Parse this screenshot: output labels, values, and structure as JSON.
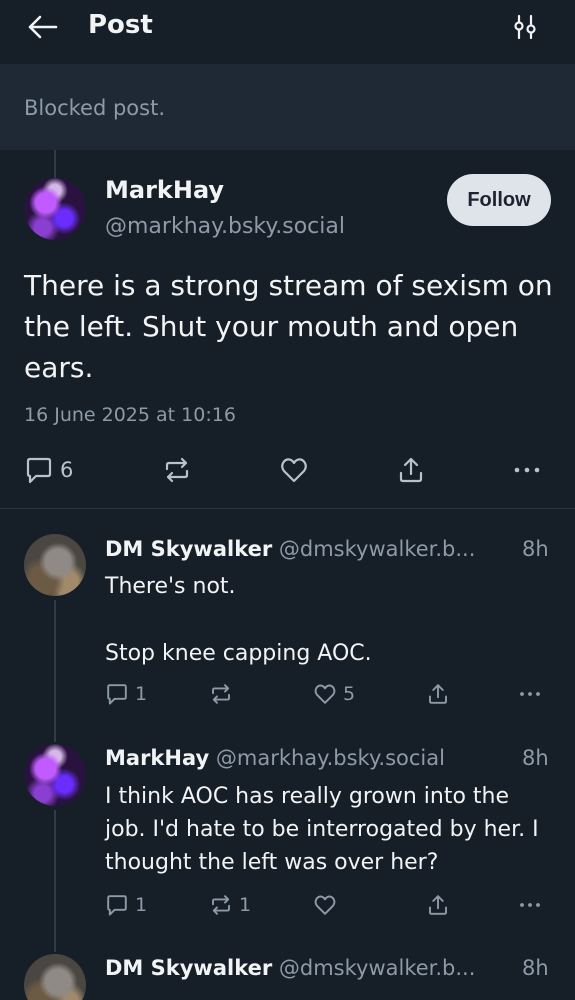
{
  "header": {
    "title": "Post",
    "back_icon": "arrow-left-icon",
    "filter_icon": "sliders-icon"
  },
  "blocked": {
    "text": "Blocked post."
  },
  "main_post": {
    "author_name": "MarkHay",
    "handle": "@markhay.bsky.social",
    "follow_label": "Follow",
    "text": "There is a strong stream of sexism on the left. Shut your mouth and open ears.",
    "timestamp": "16 June 2025 at 10:16",
    "replies": "6"
  },
  "replies": [
    {
      "author_name": "DM Skywalker",
      "handle": "@dmskywalker.b...",
      "time": "8h",
      "line1": "There's not.",
      "line2": "Stop knee capping AOC.",
      "reply_count": "1",
      "like_count": "5"
    },
    {
      "author_name": "MarkHay",
      "handle": "@markhay.bsky.social",
      "time": "8h",
      "text": "I think AOC has really grown into the job. I'd hate to be interrogated by her. I thought the left was over her?",
      "reply_count": "1",
      "repost_count": "1"
    },
    {
      "author_name": "DM Skywalker",
      "handle": "@dmskywalker.b...",
      "time": "8h"
    }
  ],
  "colors": {
    "background": "#161e27",
    "blocked_bg": "#1e2935",
    "muted_text": "#8d9aa8",
    "follow_bg": "#dfe4ea"
  }
}
